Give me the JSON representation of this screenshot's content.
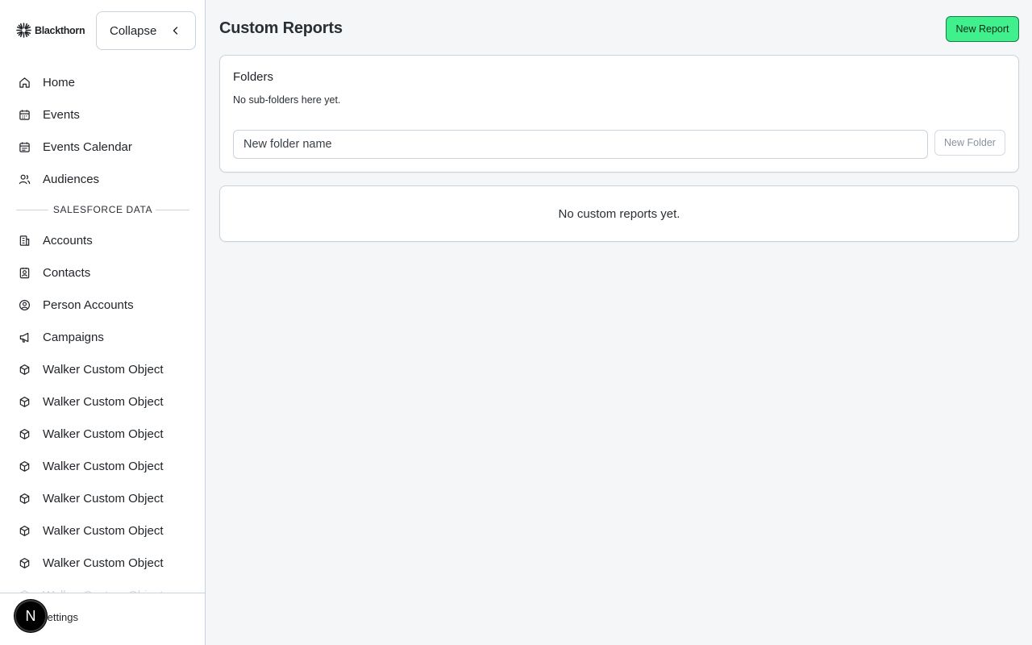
{
  "brand": {
    "name": "Blackthorn"
  },
  "sidebar": {
    "collapse_label": "Collapse",
    "primary_items": [
      {
        "label": "Home",
        "icon": "home-icon"
      },
      {
        "label": "Events",
        "icon": "calendar-icon"
      },
      {
        "label": "Events Calendar",
        "icon": "calendar-grid-icon"
      },
      {
        "label": "Audiences",
        "icon": "users-icon"
      }
    ],
    "section_label": "SALESFORCE DATA",
    "data_items": [
      {
        "label": "Accounts",
        "icon": "building-icon"
      },
      {
        "label": "Contacts",
        "icon": "contact-card-icon"
      },
      {
        "label": "Person Accounts",
        "icon": "user-circle-icon"
      },
      {
        "label": "Campaigns",
        "icon": "megaphone-icon"
      },
      {
        "label": "Walker Custom Object",
        "icon": "cube-icon"
      },
      {
        "label": "Walker Custom Object",
        "icon": "cube-icon"
      },
      {
        "label": "Walker Custom Object",
        "icon": "cube-icon"
      },
      {
        "label": "Walker Custom Object",
        "icon": "cube-icon"
      },
      {
        "label": "Walker Custom Object",
        "icon": "cube-icon"
      },
      {
        "label": "Walker Custom Object",
        "icon": "cube-icon"
      },
      {
        "label": "Walker Custom Object",
        "icon": "cube-icon"
      },
      {
        "label": "Walker Custom Object",
        "icon": "cube-icon"
      }
    ],
    "settings_label": "Settings",
    "avatar_initial": "N"
  },
  "main": {
    "title": "Custom Reports",
    "new_report_label": "New Report",
    "folders": {
      "title": "Folders",
      "empty_text": "No sub-folders here yet.",
      "input_placeholder": "New folder name",
      "new_folder_label": "New Folder"
    },
    "reports_empty_text": "No custom reports yet."
  },
  "colors": {
    "accent": "#3ff08c",
    "border": "#c9d3dc",
    "background": "#f4f6f8"
  }
}
